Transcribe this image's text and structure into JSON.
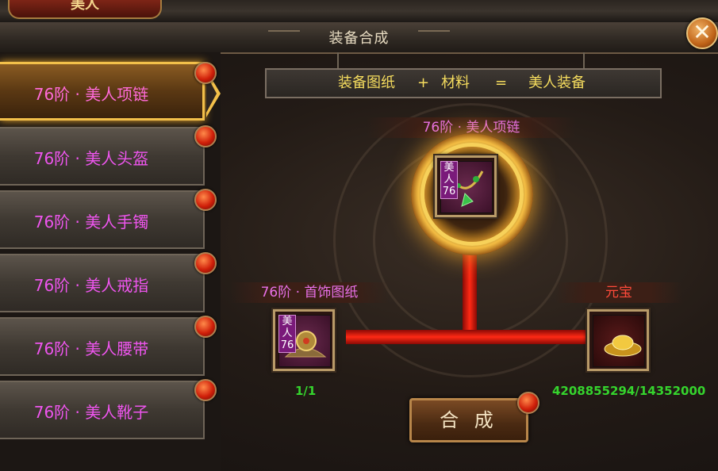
{
  "header": {
    "tab_label": "美人",
    "title": "装备合成"
  },
  "close_icon": "close-icon",
  "sidebar": {
    "items": [
      {
        "label": "76阶 · 美人项链",
        "selected": true
      },
      {
        "label": "76阶 · 美人头盔",
        "selected": false
      },
      {
        "label": "76阶 · 美人手镯",
        "selected": false
      },
      {
        "label": "76阶 · 美人戒指",
        "selected": false
      },
      {
        "label": "76阶 · 美人腰带",
        "selected": false
      },
      {
        "label": "76阶 · 美人靴子",
        "selected": false
      }
    ]
  },
  "formula": {
    "part1": "装备图纸",
    "plus": "+",
    "part2": "材料",
    "equals": "=",
    "part3": "美人装备"
  },
  "result": {
    "name": "76阶 · 美人项链",
    "tag_line1": "美",
    "tag_line2": "人",
    "tag_level": "76"
  },
  "blueprint": {
    "name": "76阶 · 首饰图纸",
    "tag_line1": "美",
    "tag_line2": "人",
    "tag_level": "76",
    "count": "1/1"
  },
  "material": {
    "name": "元宝",
    "count": "4208855294/14352000"
  },
  "synth_button": "合 成",
  "colors": {
    "item_label": "#ee55ee",
    "count_green": "#35d42d",
    "formula_yellow": "#f6dd5e",
    "material_name": "#ff4a3a",
    "result_name": "#e870e8"
  }
}
